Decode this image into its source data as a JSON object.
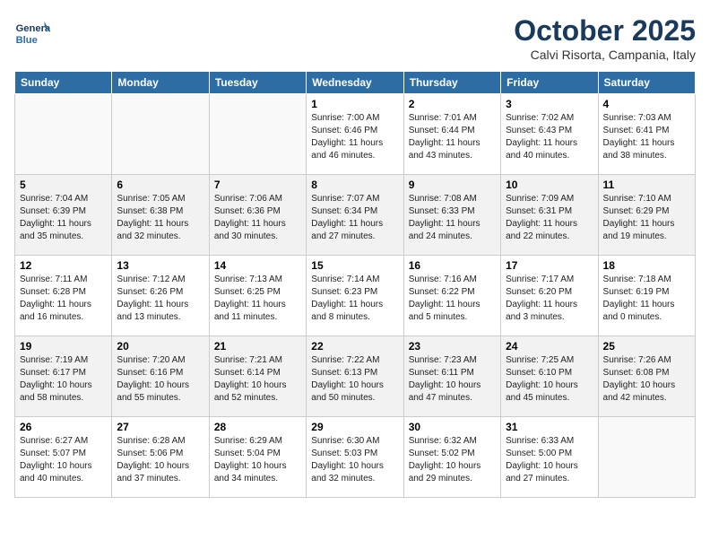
{
  "header": {
    "logo_text_general": "General",
    "logo_text_blue": "Blue",
    "month": "October 2025",
    "location": "Calvi Risorta, Campania, Italy"
  },
  "days_of_week": [
    "Sunday",
    "Monday",
    "Tuesday",
    "Wednesday",
    "Thursday",
    "Friday",
    "Saturday"
  ],
  "weeks": [
    [
      {
        "num": "",
        "info": ""
      },
      {
        "num": "",
        "info": ""
      },
      {
        "num": "",
        "info": ""
      },
      {
        "num": "1",
        "info": "Sunrise: 7:00 AM\nSunset: 6:46 PM\nDaylight: 11 hours\nand 46 minutes."
      },
      {
        "num": "2",
        "info": "Sunrise: 7:01 AM\nSunset: 6:44 PM\nDaylight: 11 hours\nand 43 minutes."
      },
      {
        "num": "3",
        "info": "Sunrise: 7:02 AM\nSunset: 6:43 PM\nDaylight: 11 hours\nand 40 minutes."
      },
      {
        "num": "4",
        "info": "Sunrise: 7:03 AM\nSunset: 6:41 PM\nDaylight: 11 hours\nand 38 minutes."
      }
    ],
    [
      {
        "num": "5",
        "info": "Sunrise: 7:04 AM\nSunset: 6:39 PM\nDaylight: 11 hours\nand 35 minutes."
      },
      {
        "num": "6",
        "info": "Sunrise: 7:05 AM\nSunset: 6:38 PM\nDaylight: 11 hours\nand 32 minutes."
      },
      {
        "num": "7",
        "info": "Sunrise: 7:06 AM\nSunset: 6:36 PM\nDaylight: 11 hours\nand 30 minutes."
      },
      {
        "num": "8",
        "info": "Sunrise: 7:07 AM\nSunset: 6:34 PM\nDaylight: 11 hours\nand 27 minutes."
      },
      {
        "num": "9",
        "info": "Sunrise: 7:08 AM\nSunset: 6:33 PM\nDaylight: 11 hours\nand 24 minutes."
      },
      {
        "num": "10",
        "info": "Sunrise: 7:09 AM\nSunset: 6:31 PM\nDaylight: 11 hours\nand 22 minutes."
      },
      {
        "num": "11",
        "info": "Sunrise: 7:10 AM\nSunset: 6:29 PM\nDaylight: 11 hours\nand 19 minutes."
      }
    ],
    [
      {
        "num": "12",
        "info": "Sunrise: 7:11 AM\nSunset: 6:28 PM\nDaylight: 11 hours\nand 16 minutes."
      },
      {
        "num": "13",
        "info": "Sunrise: 7:12 AM\nSunset: 6:26 PM\nDaylight: 11 hours\nand 13 minutes."
      },
      {
        "num": "14",
        "info": "Sunrise: 7:13 AM\nSunset: 6:25 PM\nDaylight: 11 hours\nand 11 minutes."
      },
      {
        "num": "15",
        "info": "Sunrise: 7:14 AM\nSunset: 6:23 PM\nDaylight: 11 hours\nand 8 minutes."
      },
      {
        "num": "16",
        "info": "Sunrise: 7:16 AM\nSunset: 6:22 PM\nDaylight: 11 hours\nand 5 minutes."
      },
      {
        "num": "17",
        "info": "Sunrise: 7:17 AM\nSunset: 6:20 PM\nDaylight: 11 hours\nand 3 minutes."
      },
      {
        "num": "18",
        "info": "Sunrise: 7:18 AM\nSunset: 6:19 PM\nDaylight: 11 hours\nand 0 minutes."
      }
    ],
    [
      {
        "num": "19",
        "info": "Sunrise: 7:19 AM\nSunset: 6:17 PM\nDaylight: 10 hours\nand 58 minutes."
      },
      {
        "num": "20",
        "info": "Sunrise: 7:20 AM\nSunset: 6:16 PM\nDaylight: 10 hours\nand 55 minutes."
      },
      {
        "num": "21",
        "info": "Sunrise: 7:21 AM\nSunset: 6:14 PM\nDaylight: 10 hours\nand 52 minutes."
      },
      {
        "num": "22",
        "info": "Sunrise: 7:22 AM\nSunset: 6:13 PM\nDaylight: 10 hours\nand 50 minutes."
      },
      {
        "num": "23",
        "info": "Sunrise: 7:23 AM\nSunset: 6:11 PM\nDaylight: 10 hours\nand 47 minutes."
      },
      {
        "num": "24",
        "info": "Sunrise: 7:25 AM\nSunset: 6:10 PM\nDaylight: 10 hours\nand 45 minutes."
      },
      {
        "num": "25",
        "info": "Sunrise: 7:26 AM\nSunset: 6:08 PM\nDaylight: 10 hours\nand 42 minutes."
      }
    ],
    [
      {
        "num": "26",
        "info": "Sunrise: 6:27 AM\nSunset: 5:07 PM\nDaylight: 10 hours\nand 40 minutes."
      },
      {
        "num": "27",
        "info": "Sunrise: 6:28 AM\nSunset: 5:06 PM\nDaylight: 10 hours\nand 37 minutes."
      },
      {
        "num": "28",
        "info": "Sunrise: 6:29 AM\nSunset: 5:04 PM\nDaylight: 10 hours\nand 34 minutes."
      },
      {
        "num": "29",
        "info": "Sunrise: 6:30 AM\nSunset: 5:03 PM\nDaylight: 10 hours\nand 32 minutes."
      },
      {
        "num": "30",
        "info": "Sunrise: 6:32 AM\nSunset: 5:02 PM\nDaylight: 10 hours\nand 29 minutes."
      },
      {
        "num": "31",
        "info": "Sunrise: 6:33 AM\nSunset: 5:00 PM\nDaylight: 10 hours\nand 27 minutes."
      },
      {
        "num": "",
        "info": ""
      }
    ]
  ]
}
